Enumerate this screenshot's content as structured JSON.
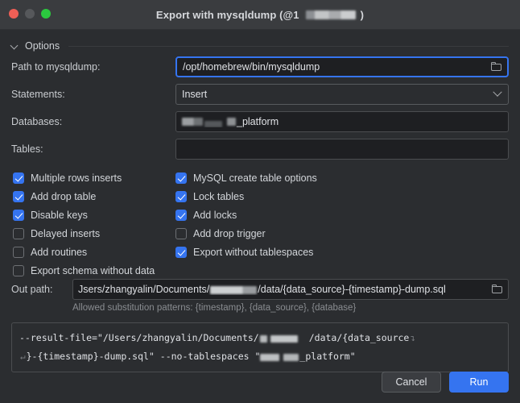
{
  "window": {
    "title_prefix": "Export with mysqldump (@1",
    "title_suffix": ")",
    "traffic_lights": [
      "close-button",
      "minimize-button",
      "maximize-button"
    ],
    "accent_color": "#3574F0",
    "background_color": "#2b2d30",
    "titlebar_color": "#3a3c3f"
  },
  "options_section": {
    "title": "Options",
    "collapse_icon": "chevron-down-icon"
  },
  "fields": {
    "path_label": "Path to mysqldump:",
    "path_value": "/opt/homebrew/bin/mysqldump",
    "path_browse_icon": "folder-icon",
    "statements_label": "Statements:",
    "statements_value": "Insert",
    "statements_arrow_icon": "chevron-down-icon",
    "databases_label": "Databases:",
    "databases_value_suffix": "_platform",
    "tables_label": "Tables:",
    "tables_value": ""
  },
  "checkboxes": {
    "column_left": [
      {
        "label": "Multiple rows inserts",
        "checked": true
      },
      {
        "label": "Add drop table",
        "checked": true
      },
      {
        "label": "Disable keys",
        "checked": true
      },
      {
        "label": "Delayed inserts",
        "checked": false
      },
      {
        "label": "Add routines",
        "checked": false
      },
      {
        "label": "Export schema without data",
        "checked": false
      }
    ],
    "column_right": [
      {
        "label": "MySQL create table options",
        "checked": true
      },
      {
        "label": "Lock tables",
        "checked": true
      },
      {
        "label": "Add locks",
        "checked": true
      },
      {
        "label": "Add drop trigger",
        "checked": false
      },
      {
        "label": "Export without tablespaces",
        "checked": true
      }
    ]
  },
  "out_path": {
    "label": "Out path:",
    "value_start": "Jsers/zhangyalin/Documents/",
    "value_end": "/data/{data_source}-{timestamp}-dump.sql",
    "browse_icon": "folder-icon",
    "hint": "Allowed substitution patterns: {timestamp}, {data_source}, {database}"
  },
  "command_preview": {
    "line1_start": "--result-file=\"/Users/zhangyalin/Documents/",
    "line1_end": "/data/{data_source",
    "line1_wrap_icon": "soft-wrap-arrow",
    "line2_wrap_icon": "soft-wrap-arrow",
    "line2_start": "}-{timestamp}-dump.sql\" --no-tablespaces \"",
    "line2_mid": "",
    "line2_end": "_platform\""
  },
  "footer": {
    "cancel_label": "Cancel",
    "run_label": "Run"
  }
}
